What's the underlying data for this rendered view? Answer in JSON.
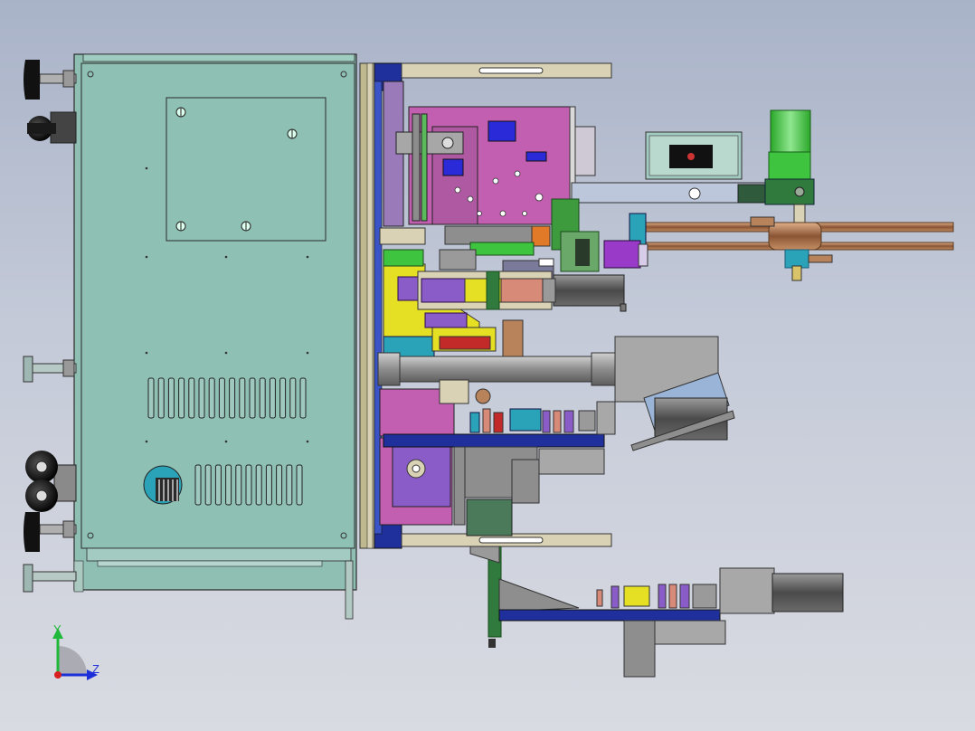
{
  "viewport": {
    "background_top": "#a9b3c8",
    "background_bottom": "#d9dbe2"
  },
  "triad": {
    "y_label": "Y",
    "z_label": "Z",
    "y_color": "#1fb83a",
    "z_color": "#1d2fd8",
    "x_color": "#d82020"
  },
  "colors": {
    "cabinet": "#8fbfb3",
    "outline": "#2a2a2a",
    "magenta": "#c25fb0",
    "purple": "#8a5cc8",
    "yellow": "#e6e024",
    "green": "#3ec43e",
    "navy": "#1f2f9c",
    "gray": "#8e8e8e",
    "copper": "#b8835a",
    "beige": "#d9d2b4",
    "teal": "#2aa3b8"
  }
}
